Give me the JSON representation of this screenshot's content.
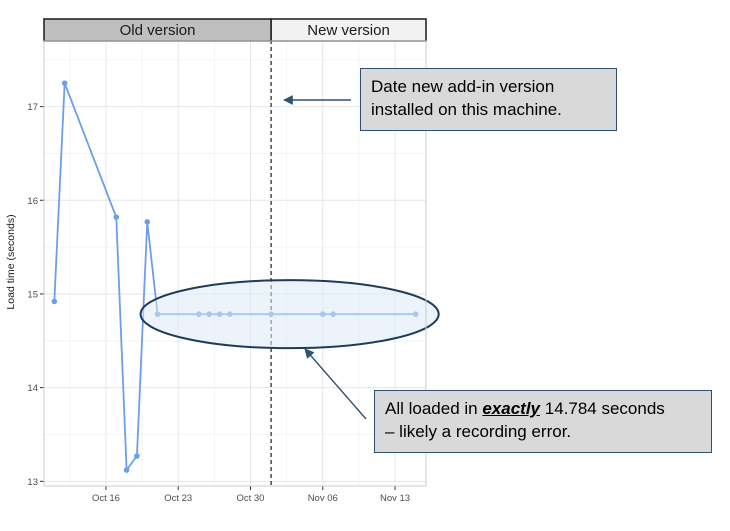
{
  "strips": {
    "left_label": "Old version",
    "right_label": "New version"
  },
  "annotations": {
    "install_note_line1": "Date new add-in version",
    "install_note_line2": "installed on this machine.",
    "error_note_pre": "All loaded in ",
    "error_note_emph": "exactly",
    "error_note_post": " 14.784 seconds",
    "error_note_line2": "– likely a recording error."
  },
  "colors": {
    "series": "#6d9eeb",
    "strip_old": "#bfbfbf",
    "strip_new": "#f2f2f2",
    "callout_fill": "#d9d9d9",
    "ellipse_fill": "#dce9f7",
    "ellipse_stroke": "#1f3b5a",
    "arrow": "#2f5271",
    "divider": "#555555"
  },
  "chart_data": {
    "type": "line",
    "ylabel": "Load time (seconds)",
    "xlabel": "",
    "x_ticks": [
      "Oct 16",
      "Oct 23",
      "Oct 30",
      "Nov 06",
      "Nov 13"
    ],
    "y_ticks": [
      13,
      14,
      15,
      16,
      17
    ],
    "xlim": [
      "2024-10-10",
      "2024-11-16"
    ],
    "ylim": [
      12.95,
      17.7
    ],
    "version_change_date": "2024-11-01",
    "series": [
      {
        "points": [
          {
            "x": "2024-10-11",
            "y": 14.92
          },
          {
            "x": "2024-10-12",
            "y": 17.25
          },
          {
            "x": "2024-10-17",
            "y": 15.82
          },
          {
            "x": "2024-10-18",
            "y": 13.12
          },
          {
            "x": "2024-10-19",
            "y": 13.27
          },
          {
            "x": "2024-10-20",
            "y": 15.77
          },
          {
            "x": "2024-10-21",
            "y": 14.784
          },
          {
            "x": "2024-10-25",
            "y": 14.784
          },
          {
            "x": "2024-10-26",
            "y": 14.784
          },
          {
            "x": "2024-10-27",
            "y": 14.784
          },
          {
            "x": "2024-10-28",
            "y": 14.784
          },
          {
            "x": "2024-11-01",
            "y": 14.784
          },
          {
            "x": "2024-11-06",
            "y": 14.784
          },
          {
            "x": "2024-11-07",
            "y": 14.784
          },
          {
            "x": "2024-11-15",
            "y": 14.784
          }
        ]
      }
    ]
  }
}
